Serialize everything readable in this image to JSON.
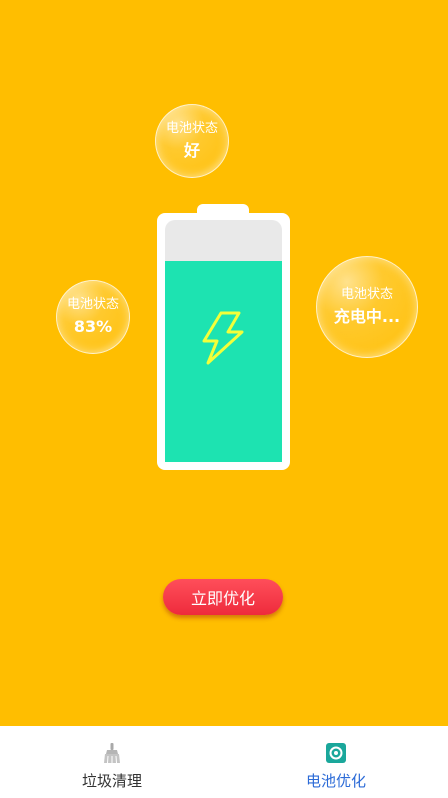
{
  "bubbles": {
    "top": {
      "label": "电池状态",
      "value": "好"
    },
    "left": {
      "label": "电池状态",
      "value": "83%"
    },
    "right": {
      "label": "电池状态",
      "value": "充电中..."
    }
  },
  "battery": {
    "level_percent": 83,
    "charging": true,
    "icon": "lightning-bolt-icon"
  },
  "action": {
    "label": "立即优化"
  },
  "tabs": [
    {
      "label": "垃圾清理",
      "icon": "broom-icon",
      "active": false
    },
    {
      "label": "电池优化",
      "icon": "battery-optimize-icon",
      "active": true
    }
  ],
  "colors": {
    "background": "#FFBE00",
    "battery_fill": "#1DE3B1",
    "button": "#EE2B3C",
    "active_tab": "#2C6BD7"
  }
}
